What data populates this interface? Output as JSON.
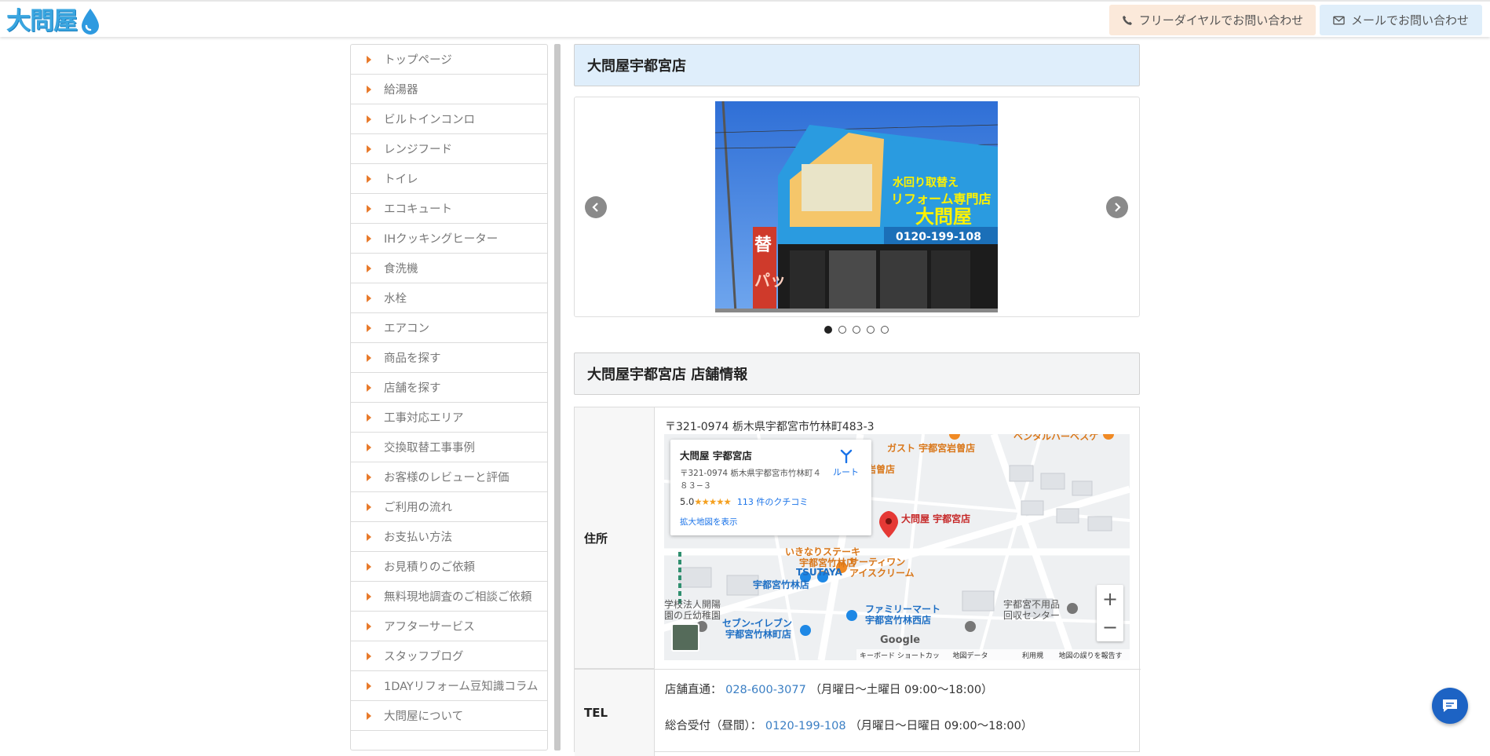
{
  "header": {
    "logo_text": "大問屋",
    "phone_button": "フリーダイヤルでお問い合わせ",
    "mail_button": "メールでお問い合わせ"
  },
  "sidebar": {
    "items": [
      {
        "label": "トップページ"
      },
      {
        "label": "給湯器"
      },
      {
        "label": "ビルトインコンロ"
      },
      {
        "label": "レンジフード"
      },
      {
        "label": "トイレ"
      },
      {
        "label": "エコキュート"
      },
      {
        "label": "IHクッキングヒーター"
      },
      {
        "label": "食洗機"
      },
      {
        "label": "水栓"
      },
      {
        "label": "エアコン"
      },
      {
        "label": "商品を探す"
      },
      {
        "label": "店舗を探す"
      },
      {
        "label": "工事対応エリア"
      },
      {
        "label": "交換取替工事事例"
      },
      {
        "label": "お客様のレビューと評価"
      },
      {
        "label": "ご利用の流れ"
      },
      {
        "label": "お支払い方法"
      },
      {
        "label": "お見積りのご依頼"
      },
      {
        "label": "無料現地調査のご相談ご依頼"
      },
      {
        "label": "アフターサービス"
      },
      {
        "label": "スタッフブログ"
      },
      {
        "label": "1DAYリフォーム豆知識コラム"
      },
      {
        "label": "大問屋について"
      }
    ]
  },
  "main": {
    "store_title": "大問屋宇都宮店",
    "carousel": {
      "slide_count": 5,
      "active_index": 0,
      "sign_phone": "0120-199-108",
      "sign_main": "大問屋",
      "sign_sub": "リフォーム専門店",
      "sign_top": "水回り取替え",
      "sign_vertical": "替",
      "sign_vertical_2": "パッ"
    },
    "info_title": "大問屋宇都宮店 店舗情報",
    "address": {
      "label": "住所",
      "text": "〒321-0974 栃木県宇都宮市竹林町483-3"
    },
    "map": {
      "card_title": "大問屋 宇都宮店",
      "card_address": "〒321-0974 栃木県宇都宮市竹林町４８３−３",
      "rating": "5.0",
      "stars": "★★★★★",
      "reviews": "113 件のクチコミ",
      "larger_map": "拡大地図を表示",
      "route": "ルート",
      "pin_label": "大問屋 宇都宮店",
      "labels": {
        "gusto": "ガスト 宇都宮岩曽店",
        "gusto_2": "宇都宮岩曽店",
        "steak": "いきなりステーキ",
        "steak_2": "宇都宮竹林店",
        "tsutaya": "TSUTAYA",
        "tsutaya_2": "宇都宮竹林店",
        "thirty_one": "サーティワン",
        "thirty_one_2": "アイスクリーム",
        "family_mart": "ファミリーマート",
        "family_mart_2": "宇都宮竹林西店",
        "seven": "セブン-イレブン",
        "seven_2": "宇都宮竹林町店",
        "recycle": "宇都宮不用品",
        "recycle_2": "回収センター",
        "kindergarten": "学校法人開陽",
        "kindergarten_2": "園の丘幼稚園",
        "top_right": "ベンタルハーベスケ"
      },
      "footer": [
        "キーボード ショートカット",
        "地図データ ©2025",
        "利用規約",
        "地図の誤りを報告する"
      ],
      "google": "Google"
    },
    "tel": {
      "label": "TEL",
      "line1_prefix": "店舗直通：",
      "line1_number": "028-600-3077",
      "line1_suffix": "（月曜日〜土曜日 09:00〜18:00）",
      "line2_prefix": "総合受付（昼間）：",
      "line2_number": "0120-199-108",
      "line2_suffix": "（月曜日〜日曜日 09:00〜18:00）"
    }
  }
}
